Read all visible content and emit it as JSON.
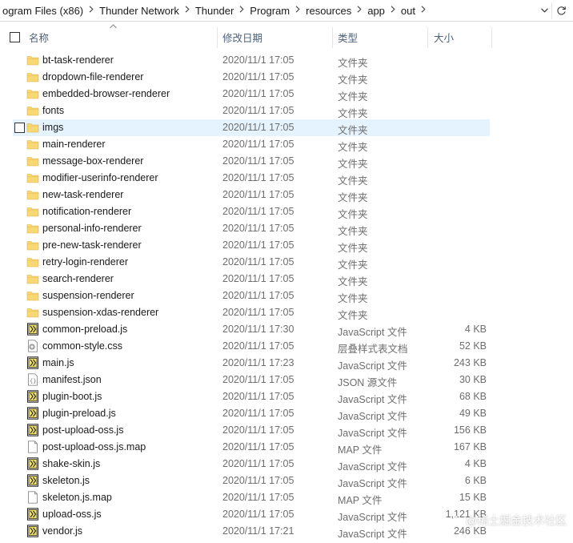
{
  "address_bar": {
    "crumbs": [
      "ogram Files (x86)",
      "Thunder Network",
      "Thunder",
      "Program",
      "resources",
      "app",
      "out"
    ]
  },
  "columns": {
    "name": "名称",
    "date": "修改日期",
    "type": "类型",
    "size": "大小"
  },
  "colors": {
    "folder": "#f8d775",
    "hover_row": "#e5f3ff",
    "header_text": "#4c607a"
  },
  "files": [
    {
      "name": "bt-task-renderer",
      "date": "2020/11/1 17:05",
      "type": "文件夹",
      "size": "",
      "icon": "folder-icon"
    },
    {
      "name": "dropdown-file-renderer",
      "date": "2020/11/1 17:05",
      "type": "文件夹",
      "size": "",
      "icon": "folder-icon"
    },
    {
      "name": "embedded-browser-renderer",
      "date": "2020/11/1 17:05",
      "type": "文件夹",
      "size": "",
      "icon": "folder-icon"
    },
    {
      "name": "fonts",
      "date": "2020/11/1 17:05",
      "type": "文件夹",
      "size": "",
      "icon": "folder-icon"
    },
    {
      "name": "imgs",
      "date": "2020/11/1 17:05",
      "type": "文件夹",
      "size": "",
      "icon": "folder-icon",
      "hover": true
    },
    {
      "name": "main-renderer",
      "date": "2020/11/1 17:05",
      "type": "文件夹",
      "size": "",
      "icon": "folder-icon"
    },
    {
      "name": "message-box-renderer",
      "date": "2020/11/1 17:05",
      "type": "文件夹",
      "size": "",
      "icon": "folder-icon"
    },
    {
      "name": "modifier-userinfo-renderer",
      "date": "2020/11/1 17:05",
      "type": "文件夹",
      "size": "",
      "icon": "folder-icon"
    },
    {
      "name": "new-task-renderer",
      "date": "2020/11/1 17:05",
      "type": "文件夹",
      "size": "",
      "icon": "folder-icon"
    },
    {
      "name": "notification-renderer",
      "date": "2020/11/1 17:05",
      "type": "文件夹",
      "size": "",
      "icon": "folder-icon"
    },
    {
      "name": "personal-info-renderer",
      "date": "2020/11/1 17:05",
      "type": "文件夹",
      "size": "",
      "icon": "folder-icon"
    },
    {
      "name": "pre-new-task-renderer",
      "date": "2020/11/1 17:05",
      "type": "文件夹",
      "size": "",
      "icon": "folder-icon"
    },
    {
      "name": "retry-login-renderer",
      "date": "2020/11/1 17:05",
      "type": "文件夹",
      "size": "",
      "icon": "folder-icon"
    },
    {
      "name": "search-renderer",
      "date": "2020/11/1 17:05",
      "type": "文件夹",
      "size": "",
      "icon": "folder-icon"
    },
    {
      "name": "suspension-renderer",
      "date": "2020/11/1 17:05",
      "type": "文件夹",
      "size": "",
      "icon": "folder-icon"
    },
    {
      "name": "suspension-xdas-renderer",
      "date": "2020/11/1 17:05",
      "type": "文件夹",
      "size": "",
      "icon": "folder-icon"
    },
    {
      "name": "common-preload.js",
      "date": "2020/11/1 17:30",
      "type": "JavaScript 文件",
      "size": "4 KB",
      "icon": "js-file-icon"
    },
    {
      "name": "common-style.css",
      "date": "2020/11/1 17:05",
      "type": "层叠样式表文档",
      "size": "52 KB",
      "icon": "css-file-icon"
    },
    {
      "name": "main.js",
      "date": "2020/11/1 17:23",
      "type": "JavaScript 文件",
      "size": "243 KB",
      "icon": "js-file-icon"
    },
    {
      "name": "manifest.json",
      "date": "2020/11/1 17:05",
      "type": "JSON 源文件",
      "size": "30 KB",
      "icon": "json-file-icon"
    },
    {
      "name": "plugin-boot.js",
      "date": "2020/11/1 17:05",
      "type": "JavaScript 文件",
      "size": "68 KB",
      "icon": "js-file-icon"
    },
    {
      "name": "plugin-preload.js",
      "date": "2020/11/1 17:05",
      "type": "JavaScript 文件",
      "size": "49 KB",
      "icon": "js-file-icon"
    },
    {
      "name": "post-upload-oss.js",
      "date": "2020/11/1 17:05",
      "type": "JavaScript 文件",
      "size": "156 KB",
      "icon": "js-file-icon"
    },
    {
      "name": "post-upload-oss.js.map",
      "date": "2020/11/1 17:05",
      "type": "MAP 文件",
      "size": "167 KB",
      "icon": "map-file-icon"
    },
    {
      "name": "shake-skin.js",
      "date": "2020/11/1 17:05",
      "type": "JavaScript 文件",
      "size": "4 KB",
      "icon": "js-file-icon"
    },
    {
      "name": "skeleton.js",
      "date": "2020/11/1 17:05",
      "type": "JavaScript 文件",
      "size": "6 KB",
      "icon": "js-file-icon"
    },
    {
      "name": "skeleton.js.map",
      "date": "2020/11/1 17:05",
      "type": "MAP 文件",
      "size": "15 KB",
      "icon": "map-file-icon"
    },
    {
      "name": "upload-oss.js",
      "date": "2020/11/1 17:05",
      "type": "JavaScript 文件",
      "size": "1,121 KB",
      "icon": "js-file-icon"
    },
    {
      "name": "vendor.js",
      "date": "2020/11/1 17:21",
      "type": "JavaScript 文件",
      "size": "246 KB",
      "icon": "js-file-icon"
    }
  ],
  "watermark": {
    "text": "@稀土掘金技术社区"
  }
}
